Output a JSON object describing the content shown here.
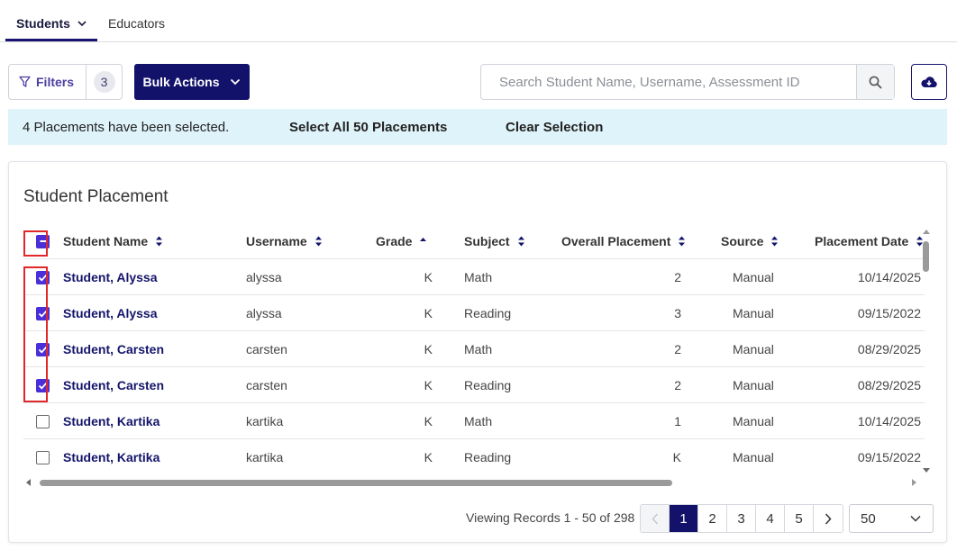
{
  "tabs": [
    {
      "label": "Students",
      "active": true
    },
    {
      "label": "Educators",
      "active": false
    }
  ],
  "toolbar": {
    "filters_label": "Filters",
    "filters_count": "3",
    "bulk_actions_label": "Bulk Actions",
    "search_placeholder": "Search Student Name, Username, Assessment ID",
    "search_value": ""
  },
  "banner": {
    "message": "4 Placements have been selected.",
    "select_all": "Select All 50 Placements",
    "clear": "Clear Selection"
  },
  "card": {
    "title": "Student Placement"
  },
  "table": {
    "columns": [
      "Student Name",
      "Username",
      "Grade",
      "Subject",
      "Overall Placement",
      "Source",
      "Placement Date"
    ],
    "sorted_column": "Grade",
    "sort_direction": "ascending",
    "rows": [
      {
        "name": "Student, Alyssa",
        "username": "alyssa",
        "grade": "K",
        "subject": "Math",
        "placement": "2",
        "source": "Manual",
        "date": "10/14/2025",
        "checked": true
      },
      {
        "name": "Student, Alyssa",
        "username": "alyssa",
        "grade": "K",
        "subject": "Reading",
        "placement": "3",
        "source": "Manual",
        "date": "09/15/2022",
        "checked": true
      },
      {
        "name": "Student, Carsten",
        "username": "carsten",
        "grade": "K",
        "subject": "Math",
        "placement": "2",
        "source": "Manual",
        "date": "08/29/2025",
        "checked": true
      },
      {
        "name": "Student, Carsten",
        "username": "carsten",
        "grade": "K",
        "subject": "Reading",
        "placement": "2",
        "source": "Manual",
        "date": "08/29/2025",
        "checked": true
      },
      {
        "name": "Student, Kartika",
        "username": "kartika",
        "grade": "K",
        "subject": "Math",
        "placement": "1",
        "source": "Manual",
        "date": "10/14/2025",
        "checked": false
      },
      {
        "name": "Student, Kartika",
        "username": "kartika",
        "grade": "K",
        "subject": "Reading",
        "placement": "K",
        "source": "Manual",
        "date": "09/15/2022",
        "checked": false
      }
    ]
  },
  "pagination": {
    "viewing": "Viewing Records 1 - 50 of 298",
    "pages": [
      "1",
      "2",
      "3",
      "4",
      "5"
    ],
    "current_page": "1",
    "page_size": "50"
  },
  "colors": {
    "primary": "#12126b",
    "checkbox": "#4b2fd6",
    "banner_bg": "#dff3fa",
    "highlight": "#e0282a"
  }
}
